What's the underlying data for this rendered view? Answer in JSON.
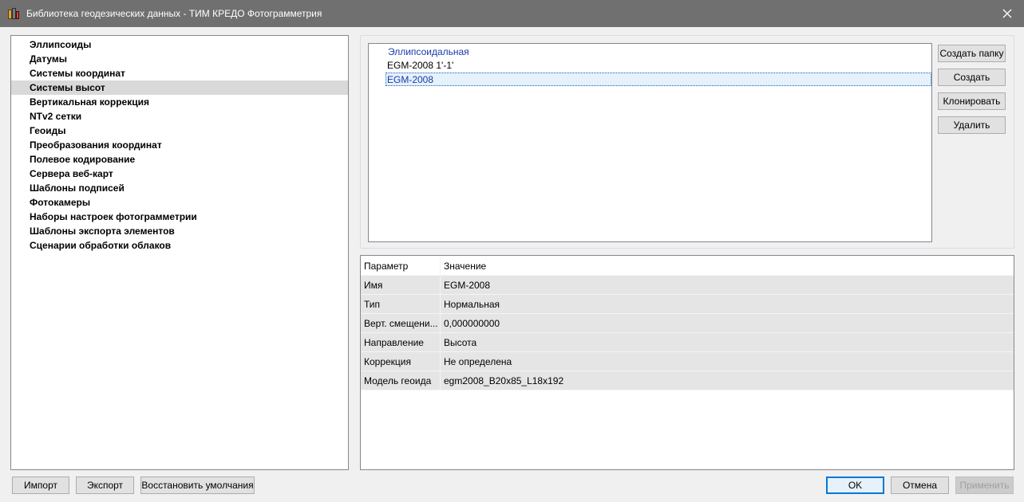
{
  "window": {
    "title": "Библиотека геодезических данных - ТИМ КРЕДО Фотограмметрия"
  },
  "categories": [
    {
      "label": "Эллипсоиды"
    },
    {
      "label": "Датумы"
    },
    {
      "label": "Системы координат"
    },
    {
      "label": "Системы высот",
      "selected": true
    },
    {
      "label": "Вертикальная коррекция"
    },
    {
      "label": "NTv2 сетки"
    },
    {
      "label": "Геоиды"
    },
    {
      "label": "Преобразования координат"
    },
    {
      "label": "Полевое кодирование"
    },
    {
      "label": "Сервера веб-карт"
    },
    {
      "label": "Шаблоны подписей"
    },
    {
      "label": "Фотокамеры"
    },
    {
      "label": "Наборы настроек фотограмметрии"
    },
    {
      "label": "Шаблоны экспорта элементов"
    },
    {
      "label": "Сценарии обработки облаков"
    }
  ],
  "tree": {
    "items": [
      {
        "label": "Эллипсоидальная",
        "kind": "folder"
      },
      {
        "label": "EGM-2008 1'-1'",
        "kind": "item"
      },
      {
        "label": "EGM-2008",
        "kind": "item",
        "selected": true
      }
    ]
  },
  "side_buttons": {
    "create_folder": "Создать папку",
    "create": "Создать",
    "clone": "Клонировать",
    "delete": "Удалить"
  },
  "properties": {
    "header": {
      "param": "Параметр",
      "value": "Значение"
    },
    "rows": [
      {
        "param": "Имя",
        "value": "EGM-2008"
      },
      {
        "param": "Тип",
        "value": "Нормальная"
      },
      {
        "param": "Верт. смещени...",
        "value": "0,000000000"
      },
      {
        "param": "Направление",
        "value": "Высота"
      },
      {
        "param": "Коррекция",
        "value": "Не определена"
      },
      {
        "param": "Модель геоида",
        "value": "egm2008_B20x85_L18x192"
      }
    ]
  },
  "bottom_buttons": {
    "import": "Импорт",
    "export": "Экспорт",
    "restore_defaults": "Восстановить умолчания",
    "ok": "OK",
    "cancel": "Отмена",
    "apply": "Применить"
  },
  "colors": {
    "titlebar": "#707070",
    "selected_category": "#d9d9d9",
    "tree_link": "#1a3aa8",
    "default_button_border": "#0078d7"
  }
}
